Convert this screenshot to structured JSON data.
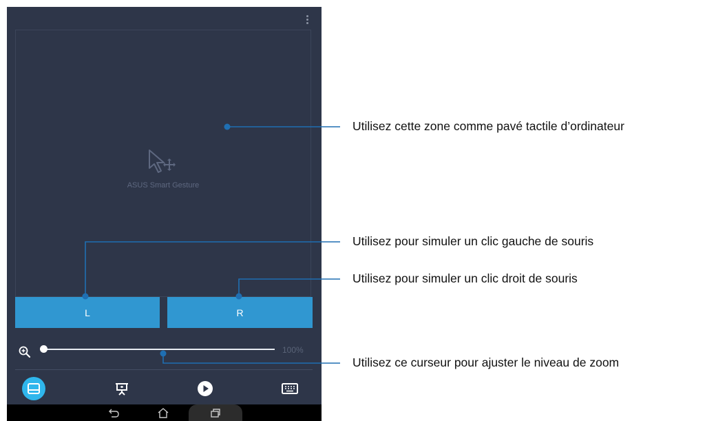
{
  "touchpad": {
    "label": "ASUS Smart Gesture",
    "logo_icon": "cursor-move-icon"
  },
  "buttons": {
    "left_label": "L",
    "right_label": "R"
  },
  "zoom": {
    "icon": "zoom-in-icon",
    "value_label": "100%",
    "level": 0.0
  },
  "bottom_nav": [
    {
      "name": "touchpad-mode",
      "icon": "touchpad-icon",
      "active": true
    },
    {
      "name": "presentation-mode",
      "icon": "presentation-icon",
      "active": false
    },
    {
      "name": "media-mode",
      "icon": "play-icon",
      "active": false
    },
    {
      "name": "keyboard-mode",
      "icon": "keyboard-icon",
      "active": false
    }
  ],
  "system_bar": {
    "icons": [
      "back-icon",
      "home-icon",
      "recents-icon"
    ]
  },
  "callouts": {
    "touchpad": "Utilisez cette zone comme pavé tactile d’ordinateur",
    "left_click": "Utilisez pour simuler un clic gauche de souris",
    "right_click": "Utilisez pour simuler un clic droit de souris",
    "zoom": "Utilisez ce curseur pour ajuster le niveau de zoom"
  },
  "colors": {
    "app_bg": "#2e3649",
    "button_blue": "#3097d1",
    "active_nav": "#2fb6ec",
    "callout_line": "#1f6fb2"
  }
}
